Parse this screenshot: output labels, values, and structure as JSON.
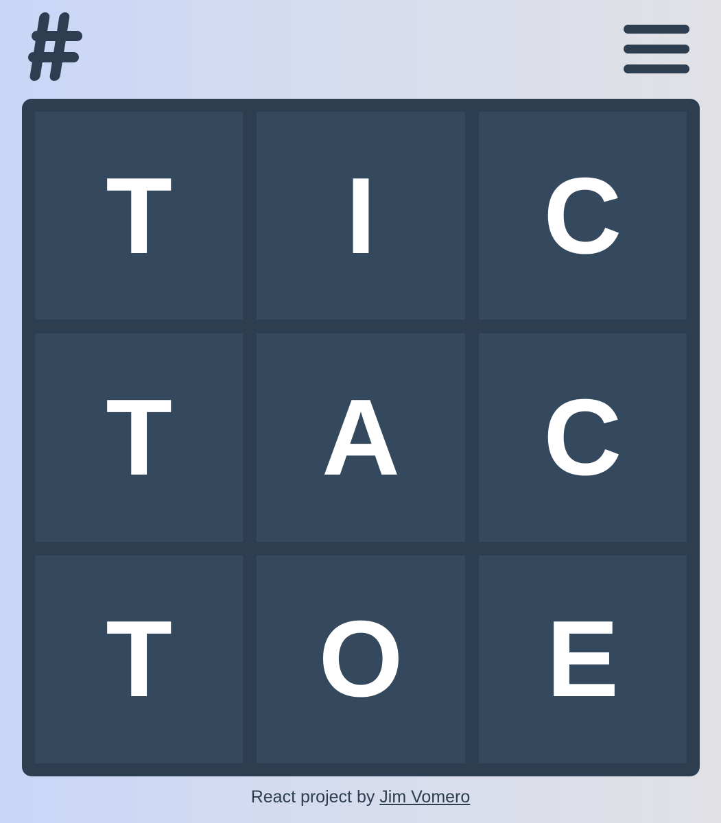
{
  "header": {
    "logo_icon": "hash-icon",
    "menu_icon": "hamburger-menu-icon"
  },
  "board": {
    "cells": [
      {
        "letter": "T"
      },
      {
        "letter": "I"
      },
      {
        "letter": "C"
      },
      {
        "letter": "T"
      },
      {
        "letter": "A"
      },
      {
        "letter": "C"
      },
      {
        "letter": "T"
      },
      {
        "letter": "O"
      },
      {
        "letter": "E"
      }
    ]
  },
  "footer": {
    "text": "React project by ",
    "author_link": "Jim Vomero"
  },
  "colors": {
    "board": "#2c3e50",
    "cell": "#35495e",
    "letter": "#ffffff",
    "icon": "#2c3e50"
  }
}
